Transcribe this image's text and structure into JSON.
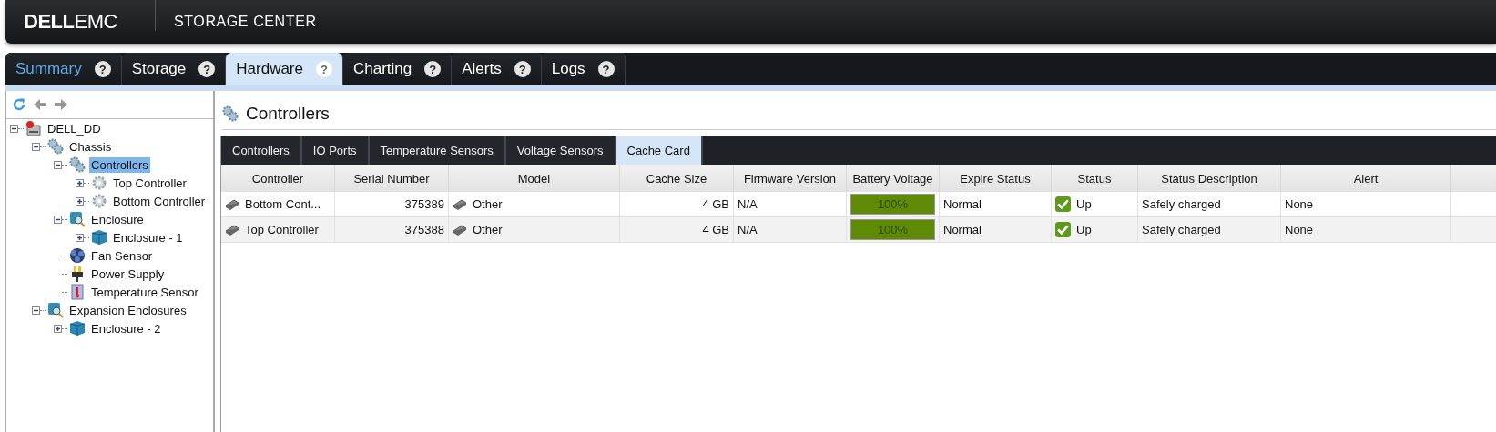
{
  "header": {
    "logo_bold": "DELL",
    "logo_light": "EMC",
    "product": "STORAGE CENTER"
  },
  "tabs": [
    {
      "label": "Summary",
      "help": "?",
      "selected": false
    },
    {
      "label": "Storage",
      "help": "?",
      "selected": false
    },
    {
      "label": "Hardware",
      "help": "?",
      "selected": true
    },
    {
      "label": "Charting",
      "help": "?",
      "selected": false
    },
    {
      "label": "Alerts",
      "help": "?",
      "selected": false
    },
    {
      "label": "Logs",
      "help": "?",
      "selected": false
    }
  ],
  "tree": [
    {
      "label": "DELL_DD",
      "kind": "server",
      "expanded": true,
      "selected": false,
      "children": [
        {
          "label": "Chassis",
          "kind": "gears",
          "expanded": true,
          "selected": false,
          "children": [
            {
              "label": "Controllers",
              "kind": "gears",
              "expanded": true,
              "selected": true,
              "children": [
                {
                  "label": "Top Controller",
                  "kind": "gear",
                  "expanded": false,
                  "selected": false
                },
                {
                  "label": "Bottom Controller",
                  "kind": "gear",
                  "expanded": false,
                  "selected": false
                }
              ]
            },
            {
              "label": "Enclosure",
              "kind": "enclosure",
              "expanded": true,
              "selected": false,
              "children": [
                {
                  "label": "Enclosure - 1",
                  "kind": "cube",
                  "expanded": false,
                  "selected": false
                }
              ]
            },
            {
              "label": "Fan Sensor",
              "kind": "fan",
              "selected": false
            },
            {
              "label": "Power Supply",
              "kind": "plug",
              "selected": false
            },
            {
              "label": "Temperature Sensor",
              "kind": "thermometer",
              "selected": false
            }
          ]
        },
        {
          "label": "Expansion Enclosures",
          "kind": "enclosure",
          "expanded": true,
          "selected": false,
          "children": [
            {
              "label": "Enclosure - 2",
              "kind": "cube",
              "expanded": false,
              "selected": false
            }
          ]
        }
      ]
    }
  ],
  "page_title": "Controllers",
  "subtabs": [
    {
      "label": "Controllers",
      "selected": false
    },
    {
      "label": "IO Ports",
      "selected": false
    },
    {
      "label": "Temperature Sensors",
      "selected": false
    },
    {
      "label": "Voltage Sensors",
      "selected": false
    },
    {
      "label": "Cache Card",
      "selected": true
    }
  ],
  "table": {
    "columns": [
      "Controller",
      "Serial Number",
      "Model",
      "Cache Size",
      "Firmware Version",
      "Battery Voltage",
      "Expire Status",
      "Status",
      "Status Description",
      "Alert"
    ],
    "rows": [
      {
        "controller": "Bottom Cont...",
        "serial": "375389",
        "model": "Other",
        "cache_size": "4 GB",
        "firmware": "N/A",
        "battery": {
          "level": 1,
          "reading": "100%"
        },
        "expire": "Normal",
        "status": "Up",
        "description": "Safely charged",
        "alert": "None"
      },
      {
        "controller": "Top Controller",
        "serial": "375388",
        "model": "Other",
        "cache_size": "4 GB",
        "firmware": "N/A",
        "battery": {
          "level": 1,
          "reading": "100%"
        },
        "expire": "Normal",
        "status": "Up",
        "description": "Safely charged",
        "alert": "None"
      }
    ]
  }
}
